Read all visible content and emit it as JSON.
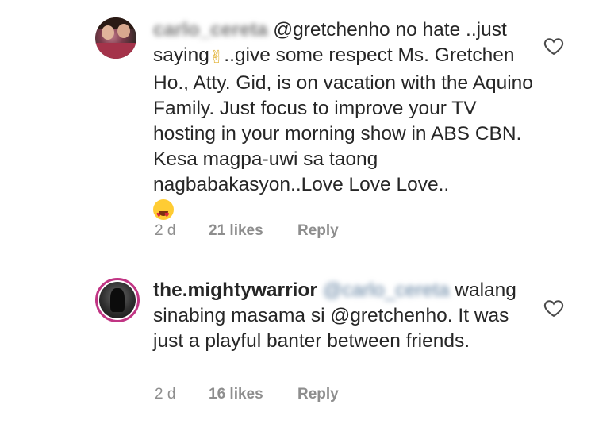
{
  "comments": [
    {
      "username_blurred": "carlo_cereta",
      "mention": "@gretchenho",
      "text_after_mention": " no hate ..just saying",
      "victory_emoji": "✌",
      "text_rest": "..give some respect Ms. Gretchen Ho., Atty. Gid, is on vacation with the Aquino Family. Just focus to improve your TV hosting in your morning show in ABS CBN. Kesa magpa-uwi sa taong nagbabakasyon..Love Love Love..",
      "end_emoji": "heart-eyes-emoji",
      "age": "2 d",
      "likes": "21 likes",
      "reply": "Reply",
      "like_icon": "heart-outline-icon"
    },
    {
      "username": "the.mightywarrior",
      "mention_blurred": "@carlo_cereta",
      "text": " walang sinabing masama si @gretchenho. It was just a playful banter between friends.",
      "age": "2 d",
      "likes": "16 likes",
      "reply": "Reply",
      "like_icon": "heart-outline-icon"
    }
  ],
  "colors": {
    "text": "#262626",
    "muted": "#8e8e8e",
    "story_ring": "#c13584"
  }
}
